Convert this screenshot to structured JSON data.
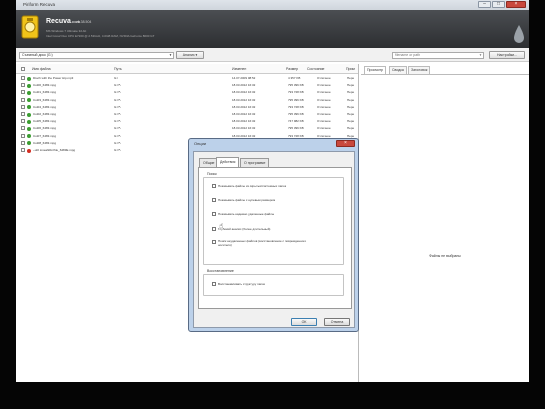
{
  "window": {
    "title": "Piriform Recuva"
  },
  "header": {
    "app_name": "Recuva",
    "app_suffix": ".com",
    "version": "v1.38.504",
    "sys_line1": "MS Windows 7 Ultimate 32-bit",
    "sys_line2": "Intel Core2 Duo CPU E7200 @ 2.53GHz, 4.0GB RAM, NVIDIA GeForce 8600 GT"
  },
  "toolbar": {
    "drive_select": "Съемный диск (G:)",
    "scan_button": "Анализ",
    "search_placeholder": "filename or path",
    "settings_button": "Настройки..."
  },
  "grid": {
    "columns": [
      "Имя файла",
      "Путь",
      "Изменен",
      "Размер",
      "Состояние",
      "Прим"
    ],
    "rows": [
      {
        "status": "green",
        "name": "Dtoch with the Power Hip.mp3",
        "path": "G:\\",
        "modified": "14.07.2009 08:52",
        "size": "4 357 KB",
        "state": "Отличное",
        "note": "Пере"
      },
      {
        "status": "green",
        "name": "Cut00_6483.mpg",
        "path": "G:\\?\\",
        "modified": "18.03.2012 16:32",
        "size": "795 396 KB",
        "state": "Отличное",
        "note": "Пере"
      },
      {
        "status": "green",
        "name": "Cut01_6483.mpg",
        "path": "G:\\?\\",
        "modified": "18.03.2012 16:32",
        "size": "793 728 KB",
        "state": "Отличное",
        "note": "Пере"
      },
      {
        "status": "green",
        "name": "Cut03_6483.mpg",
        "path": "G:\\?\\",
        "modified": "18.03.2012 16:32",
        "size": "795 396 KB",
        "state": "Отличное",
        "note": "Пере"
      },
      {
        "status": "green",
        "name": "Cut04_6483.mpg",
        "path": "G:\\?\\",
        "modified": "18.03.2012 16:32",
        "size": "793 728 KB",
        "state": "Отличное",
        "note": "Пере"
      },
      {
        "status": "green",
        "name": "Cut02_6483.mpg",
        "path": "G:\\?\\",
        "modified": "18.03.2012 16:32",
        "size": "795 396 KB",
        "state": "Отличное",
        "note": "Пере"
      },
      {
        "status": "green",
        "name": "Cut05_6483.mpg",
        "path": "G:\\?\\",
        "modified": "18.03.2012 16:32",
        "size": "747 982 KB",
        "state": "Отличное",
        "note": "Пере"
      },
      {
        "status": "green",
        "name": "Cut06_6483.mpg",
        "path": "G:\\?\\",
        "modified": "18.03.2012 16:32",
        "size": "795 396 KB",
        "state": "Отличное",
        "note": "Пере"
      },
      {
        "status": "green",
        "name": "Cut07_6483.mpg",
        "path": "G:\\?\\",
        "modified": "18.03.2012 16:32",
        "size": "793 728 KB",
        "state": "Отличное",
        "note": "Пере"
      },
      {
        "status": "green",
        "name": "Cut08_6483.mpg",
        "path": "G:\\?\\",
        "modified": "18.03.2012 16:32",
        "size": "795 396 KB",
        "state": "Отличное",
        "note": "Пере"
      },
      {
        "status": "red",
        "name": "~ut0 LinealWorthle_6483E.mpg",
        "path": "G:\\?\\",
        "modified": "18.03.2012 16:32",
        "size": "793 728 KB",
        "state": "Отличное",
        "note": "Пере"
      }
    ]
  },
  "right_panel": {
    "tabs": [
      "Просмотр",
      "Сводка",
      "Заголовок"
    ],
    "message": "Файлы не выбраны"
  },
  "dialog": {
    "title": "Опции",
    "tabs": [
      "Общие",
      "Действия",
      "О программе"
    ],
    "group1_label": "Поиск",
    "options": [
      "Показывать файлы из скрытых/системных папок",
      "Показывать файлы с нулевым размером",
      "Показывать надежно удаленные файлы",
      "Глубокий анализ (более длительный)",
      "Поиск неудаленных файлов (восстановление с поврежденного носителя)"
    ],
    "group2_label": "Восстановление",
    "restore_option": "Восстанавливать структуру папок",
    "ok_button": "ОК",
    "cancel_button": "Отмена"
  }
}
